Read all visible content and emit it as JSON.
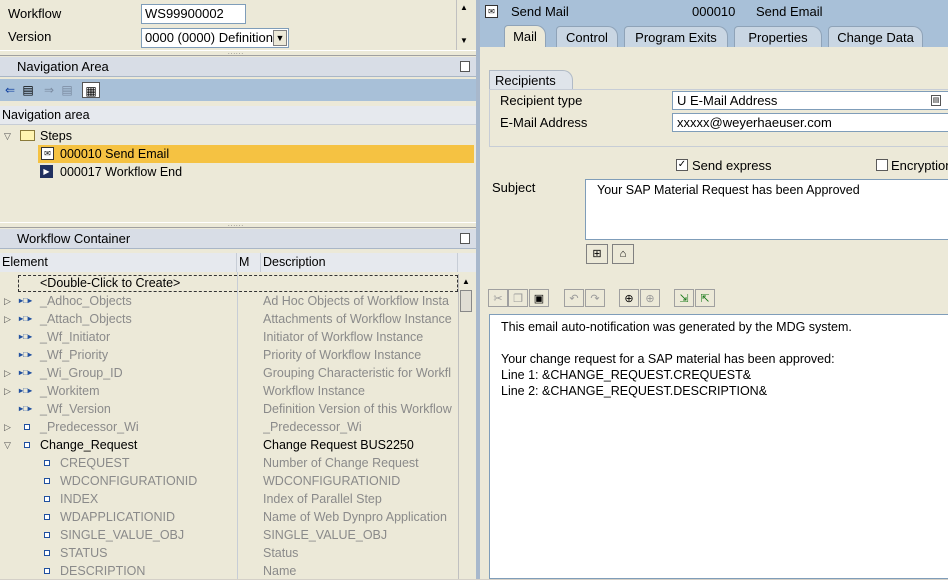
{
  "header": {
    "workflow_label": "Workflow",
    "workflow_value": "WS99900002",
    "version_label": "Version",
    "version_value": "0000 (0000) Definition"
  },
  "navigation_area": {
    "panel_title": "Navigation Area",
    "area_label": "Navigation area",
    "tree": {
      "root_label": "Steps",
      "items": [
        {
          "label": "000010 Send Email",
          "selected": true
        },
        {
          "label": "000017 Workflow End",
          "selected": false
        }
      ]
    }
  },
  "workflow_container": {
    "panel_title": "Workflow Container",
    "columns": {
      "element": "Element",
      "m": "M",
      "description": "Description"
    },
    "create_row": "<Double-Click to Create>",
    "rows": [
      {
        "element": "_Adhoc_Objects",
        "description": "Ad Hoc Objects of Workflow Insta",
        "gray": true,
        "expand": true
      },
      {
        "element": "_Attach_Objects",
        "description": "Attachments of Workflow Instance",
        "gray": true,
        "expand": true
      },
      {
        "element": "_Wf_Initiator",
        "description": "Initiator of Workflow Instance",
        "gray": true,
        "expand": false
      },
      {
        "element": "_Wf_Priority",
        "description": "Priority of Workflow Instance",
        "gray": true,
        "expand": false
      },
      {
        "element": "_Wi_Group_ID",
        "description": "Grouping Characteristic for Workfl",
        "gray": true,
        "expand": true
      },
      {
        "element": "_Workitem",
        "description": "Workflow Instance",
        "gray": true,
        "expand": true
      },
      {
        "element": "_Wf_Version",
        "description": "Definition Version of this Workflow",
        "gray": true,
        "expand": false
      },
      {
        "element": "_Predecessor_Wi",
        "description": "_Predecessor_Wi",
        "gray": true,
        "expand": true
      },
      {
        "element": "Change_Request",
        "description": "Change Request BUS2250",
        "gray": false,
        "expand": true
      },
      {
        "element": "CREQUEST",
        "description": "Number of Change Request",
        "gray": true,
        "child": true
      },
      {
        "element": "WDCONFIGURATIONID",
        "description": "WDCONFIGURATIONID",
        "gray": true,
        "child": true
      },
      {
        "element": "INDEX",
        "description": "Index of Parallel Step",
        "gray": true,
        "child": true
      },
      {
        "element": "WDAPPLICATIONID",
        "description": "Name of Web Dynpro Application",
        "gray": true,
        "child": true
      },
      {
        "element": "SINGLE_VALUE_OBJ",
        "description": "SINGLE_VALUE_OBJ",
        "gray": true,
        "child": true
      },
      {
        "element": "STATUS",
        "description": "Status",
        "gray": true,
        "child": true
      },
      {
        "element": "DESCRIPTION",
        "description": "Name",
        "gray": true,
        "child": true
      }
    ]
  },
  "step": {
    "type_label": "Send Mail",
    "number": "000010",
    "name": "Send Email",
    "tabs": [
      "Mail",
      "Control",
      "Program Exits",
      "Properties",
      "Change Data"
    ],
    "active_tab": "Mail"
  },
  "mail": {
    "recipients_group": "Recipients",
    "recipient_type_label": "Recipient type",
    "recipient_type_value": "U E-Mail Address",
    "email_label": "E-Mail Address",
    "email_value": "xxxxx@weyerhaeuser.com",
    "send_express_label": "Send express",
    "send_express_checked": true,
    "encryption_label": "Encryption",
    "encryption_checked": false,
    "subject_label": "Subject",
    "subject_value": "Your SAP Material Request has been Approved",
    "body_lines": [
      "This email auto-notification was generated by the MDG system.",
      "",
      "Your change request for a SAP material has been approved:",
      "Line 1: &CHANGE_REQUEST.CREQUEST&",
      "Line 2: &CHANGE_REQUEST.DESCRIPTION&"
    ]
  },
  "colors": {
    "selection": "#f5c242",
    "toolbar_blue": "#a8c0d8",
    "panel_bg": "#ece9d8"
  }
}
